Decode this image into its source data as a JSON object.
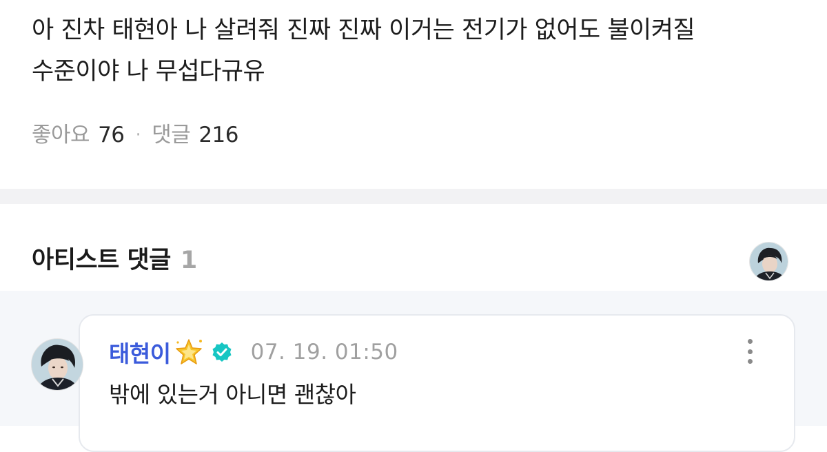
{
  "post": {
    "body_line1": "아 진차 태현아 나 살려줘 진짜 진짜 이거는 전기가 없어도 불이켜질",
    "body_line2": "수준이야 나 무섭다규유",
    "likes_label": "좋아요",
    "likes_count": "76",
    "separator": "·",
    "comments_label": "댓글",
    "comments_count": "216"
  },
  "artist_comments": {
    "title": "아티스트 댓글",
    "count": "1",
    "avatar_icon": "artist-avatar-icon"
  },
  "comment": {
    "author": "태현이",
    "author_icon": "sparkle-star-icon",
    "verified_icon": "verified-badge-icon",
    "timestamp": "07. 19. 01:50",
    "text": "밖에 있는거 아니면 괜찮아",
    "more_icon": "more-vertical-icon"
  },
  "colors": {
    "author": "#3b5bdb",
    "verified": "#17c6c3",
    "star": "#f5b820",
    "muted": "#9a9a9a",
    "band": "#f2f2f4",
    "comment_bg": "#f5f7fa"
  }
}
